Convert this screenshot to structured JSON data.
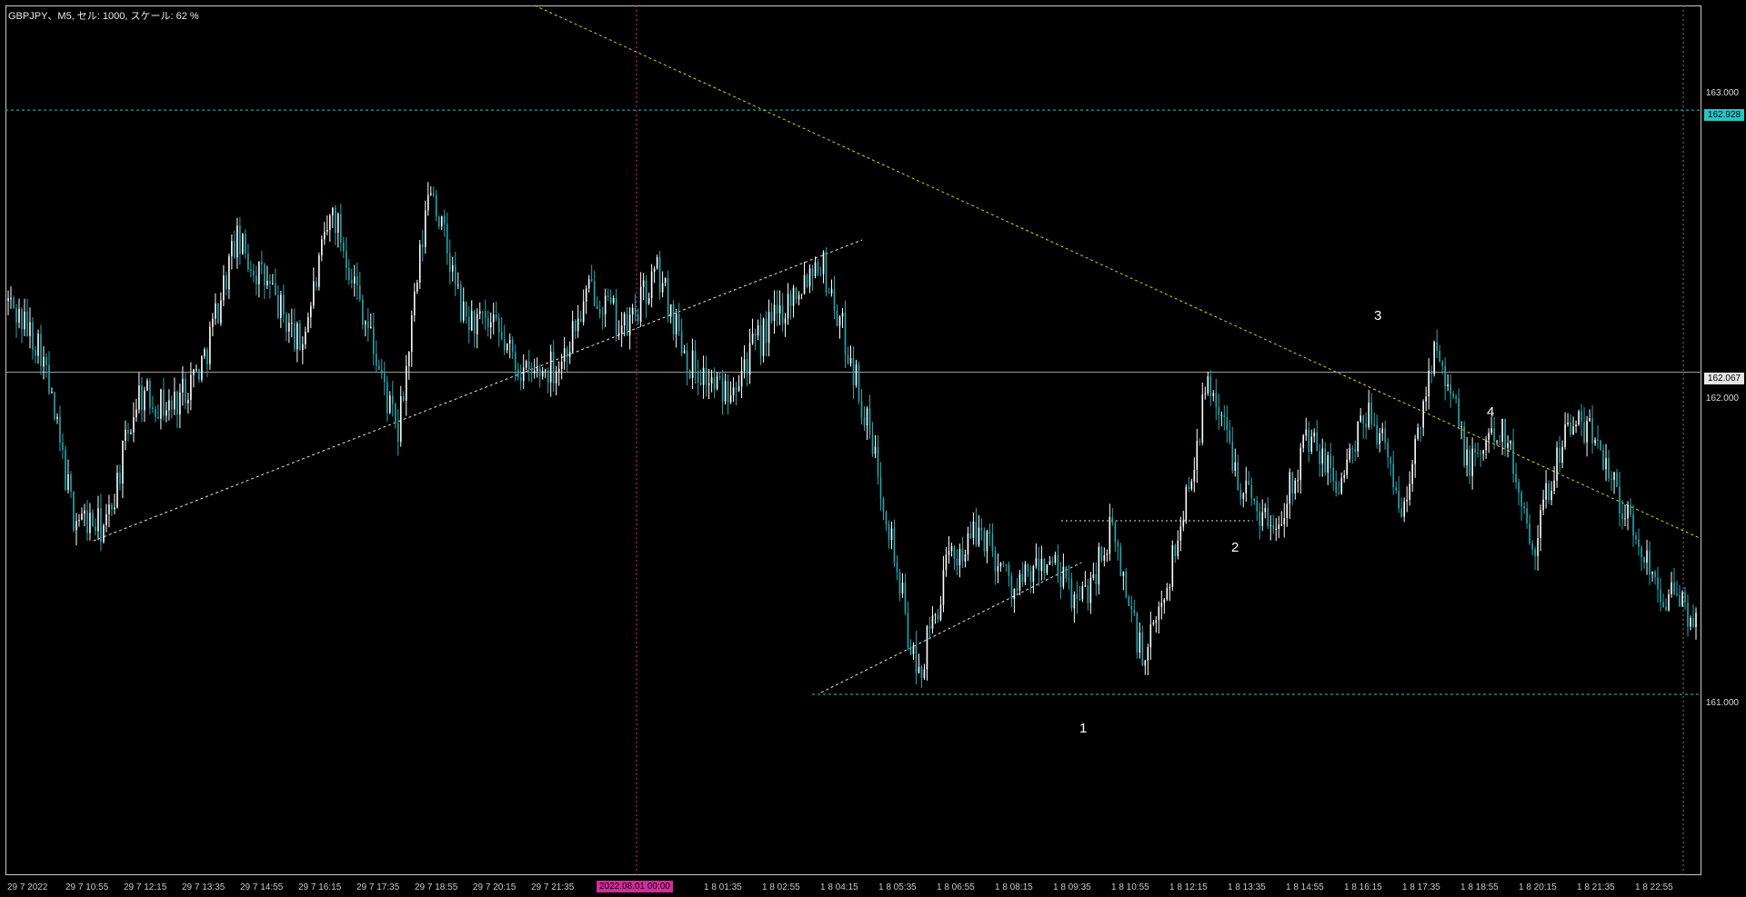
{
  "chart_data": {
    "type": "candlestick",
    "symbol": "GBPJPY",
    "header": "GBPJPY、M5, セル: 1000, スケール: 62 %",
    "price_range": [
      160.5,
      163.3
    ],
    "price_ticks": [
      "163.000",
      "162.000",
      "161.000"
    ],
    "price_markers": {
      "resistance": {
        "value": 162.928,
        "label": "162.928"
      },
      "current": {
        "value": 162.067,
        "label": "162.067"
      }
    },
    "time_labels": [
      "29 7 2022",
      "29 7 10:55",
      "29 7 12:15",
      "29 7 13:35",
      "29 7 14:55",
      "29 7 16:15",
      "29 7 17:35",
      "29 7 18:55",
      "29 7 20:15",
      "29 7 21:35",
      "1 8 01:35",
      "1 8 02:55",
      "1 8 04:15",
      "1 8 05:35",
      "1 8 06:55",
      "1 8 08:15",
      "1 8 09:35",
      "1 8 10:55",
      "1 8 12:15",
      "1 8 13:35",
      "1 8 14:55",
      "1 8 16:15",
      "1 8 17:35",
      "1 8 18:55",
      "1 8 20:15",
      "1 8 21:35",
      "1 8 22:55"
    ],
    "time_cursor_label": "2022.08.01 00:00",
    "wave_labels": [
      "1",
      "2",
      "3",
      "4"
    ],
    "grid": false,
    "series_anchor_prices": [
      162.3,
      162.15,
      161.6,
      161.55,
      162.0,
      161.95,
      162.1,
      162.5,
      162.35,
      162.15,
      162.6,
      162.25,
      161.85,
      162.7,
      162.25,
      162.2,
      162.05,
      162.1,
      162.35,
      162.2,
      162.4,
      162.1,
      162.0,
      162.15,
      162.3,
      162.45,
      162.1,
      161.65,
      161.05,
      161.45,
      161.55,
      161.35,
      161.45,
      161.3,
      161.55,
      161.1,
      161.5,
      162.05,
      161.7,
      161.55,
      161.85,
      161.7,
      161.95,
      161.6,
      162.2,
      161.75,
      161.9,
      161.5,
      161.9,
      161.85,
      161.55,
      161.35,
      161.25
    ]
  },
  "colors": {
    "background": "#000000",
    "candle_up": "#ffffff",
    "candle_down": "#22a9b0",
    "resistance_line": "#22c7c7",
    "support_line": "#22c7c7",
    "current_line": "#9a9a9a",
    "trendline": "#e0e0e0",
    "downtrend": "#d4d400",
    "time_cursor": "#d62a9a"
  }
}
